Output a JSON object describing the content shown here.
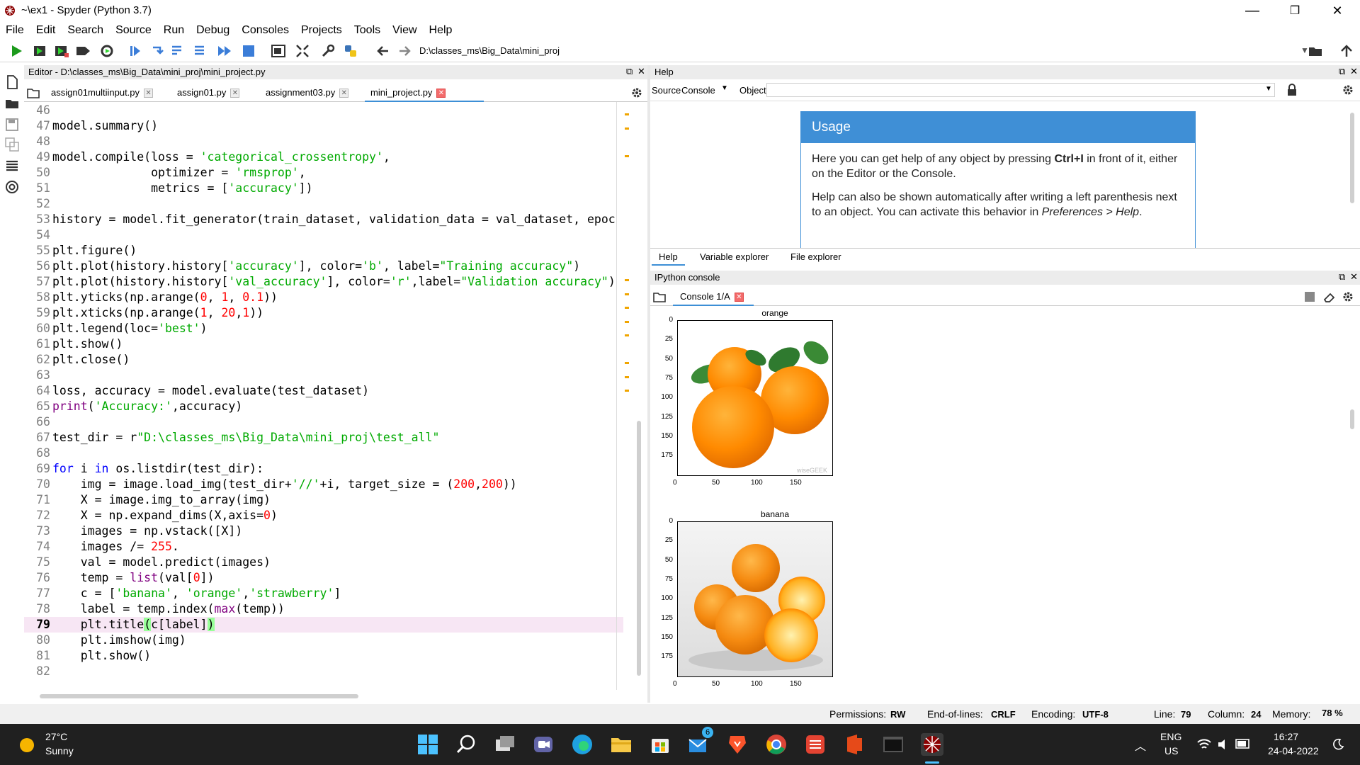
{
  "window": {
    "title": "~\\ex1 - Spyder (Python 3.7)",
    "minimize": "—",
    "restore": "❐",
    "close": "✕"
  },
  "menu": [
    "File",
    "Edit",
    "Search",
    "Source",
    "Run",
    "Debug",
    "Consoles",
    "Projects",
    "Tools",
    "View",
    "Help"
  ],
  "toolbar": {
    "path": "D:\\classes_ms\\Big_Data\\mini_proj"
  },
  "editor": {
    "header": "Editor - D:\\classes_ms\\Big_Data\\mini_proj\\mini_project.py",
    "tabs": [
      {
        "label": "assign01multiinput.py",
        "active": false
      },
      {
        "label": "assign01.py",
        "active": false
      },
      {
        "label": "assignment03.py",
        "active": false
      },
      {
        "label": "mini_project.py",
        "active": true
      }
    ],
    "current_line": 79,
    "lines": [
      {
        "n": "46",
        "html": ""
      },
      {
        "n": "47",
        "html": "model.summary()"
      },
      {
        "n": "48",
        "html": ""
      },
      {
        "n": "49",
        "html": "model.compile(loss = <span class='st'>'categorical_crossentropy'</span>,"
      },
      {
        "n": "50",
        "html": "              optimizer = <span class='st'>'rmsprop'</span>,"
      },
      {
        "n": "51",
        "html": "              metrics = [<span class='st'>'accuracy'</span>])"
      },
      {
        "n": "52",
        "html": ""
      },
      {
        "n": "53",
        "html": "history = model.fit_generator(train_dataset, validation_data = val_dataset, epoc"
      },
      {
        "n": "54",
        "html": ""
      },
      {
        "n": "55",
        "html": "plt.figure()"
      },
      {
        "n": "56",
        "html": "plt.plot(history.history[<span class='st'>'accuracy'</span>], color=<span class='st'>'b'</span>, label=<span class='st'>\"Training accuracy\"</span>)"
      },
      {
        "n": "57",
        "html": "plt.plot(history.history[<span class='st'>'val_accuracy'</span>], color=<span class='st'>'r'</span>,label=<span class='st'>\"Validation accuracy\"</span>)"
      },
      {
        "n": "58",
        "html": "plt.yticks(np.arange(<span class='nm'>0</span>, <span class='nm'>1</span>, <span class='nm'>0.1</span>))"
      },
      {
        "n": "59",
        "html": "plt.xticks(np.arange(<span class='nm'>1</span>, <span class='nm'>20</span>,<span class='nm'>1</span>))"
      },
      {
        "n": "60",
        "html": "plt.legend(loc=<span class='st'>'best'</span>)"
      },
      {
        "n": "61",
        "html": "plt.show()"
      },
      {
        "n": "62",
        "html": "plt.close()"
      },
      {
        "n": "63",
        "html": ""
      },
      {
        "n": "64",
        "html": "loss, accuracy = model.evaluate(test_dataset)"
      },
      {
        "n": "65",
        "html": "<span class='bi'>print</span>(<span class='st'>'Accuracy:'</span>,accuracy)"
      },
      {
        "n": "66",
        "html": ""
      },
      {
        "n": "67",
        "html": "test_dir = r<span class='st'>\"D:\\classes_ms\\Big_Data\\mini_proj\\test_all\"</span>"
      },
      {
        "n": "68",
        "html": ""
      },
      {
        "n": "69",
        "html": "<span class='kw'>for</span> i <span class='kw'>in</span> os.listdir(test_dir):"
      },
      {
        "n": "70",
        "html": "    img = image.load_img(test_dir+<span class='st'>'//'</span>+i, target_size = (<span class='nm'>200</span>,<span class='nm'>200</span>))"
      },
      {
        "n": "71",
        "html": "    X = image.img_to_array(img)"
      },
      {
        "n": "72",
        "html": "    X = np.expand_dims(X,axis=<span class='nm'>0</span>)"
      },
      {
        "n": "73",
        "html": "    images = np.vstack([X])"
      },
      {
        "n": "74",
        "html": "    images /= <span class='nm'>255</span>."
      },
      {
        "n": "75",
        "html": "    val = model.predict(images)"
      },
      {
        "n": "76",
        "html": "    temp = <span class='bi'>list</span>(val[<span class='nm'>0</span>])"
      },
      {
        "n": "77",
        "html": "    c = [<span class='st'>'banana'</span>, <span class='st'>'orange'</span>,<span class='st'>'strawberry'</span>]"
      },
      {
        "n": "78",
        "html": "    label = temp.index(<span class='bi'>max</span>(temp))"
      },
      {
        "n": "79",
        "html": "    plt.title<span class='hl'>(</span>c[label]<span class='hl'>)</span>"
      },
      {
        "n": "80",
        "html": "    plt.imshow(img)"
      },
      {
        "n": "81",
        "html": "    plt.show()"
      },
      {
        "n": "82",
        "html": ""
      }
    ]
  },
  "help": {
    "header": "Help",
    "source_label": "Source",
    "source_value": "Console",
    "object_label": "Object",
    "usage_title": "Usage",
    "usage_p1_a": "Here you can get help of any object by pressing ",
    "usage_p1_key": "Ctrl+I",
    "usage_p1_b": " in front of it, either on the Editor or the Console.",
    "usage_p2_a": "Help can also be shown automatically after writing a left parenthesis next to an object. You can activate this behavior in ",
    "usage_p2_link": "Preferences > Help",
    "usage_p2_b": ".",
    "tabs": [
      "Help",
      "Variable explorer",
      "File explorer"
    ]
  },
  "ipython": {
    "header": "IPython console",
    "tab_label": "Console 1/A",
    "plots": [
      {
        "title": "orange",
        "yticks": [
          "0",
          "25",
          "50",
          "75",
          "100",
          "125",
          "150",
          "175"
        ],
        "xticks": [
          "0",
          "50",
          "100",
          "150"
        ],
        "watermark": "wiseGEEK"
      },
      {
        "title": "banana",
        "yticks": [
          "0",
          "25",
          "50",
          "75",
          "100",
          "125",
          "150",
          "175"
        ],
        "xticks": [
          "0",
          "50",
          "100",
          "150"
        ]
      }
    ]
  },
  "status": {
    "permissions_label": "Permissions:",
    "permissions": "RW",
    "eol_label": "End-of-lines:",
    "eol": "CRLF",
    "encoding_label": "Encoding:",
    "encoding": "UTF-8",
    "line_label": "Line:",
    "line": "79",
    "column_label": "Column:",
    "column": "24",
    "memory_label": "Memory:",
    "memory": "78 %"
  },
  "taskbar": {
    "temp": "27°C",
    "condition": "Sunny",
    "lang1": "ENG",
    "lang2": "US",
    "time": "16:27",
    "date": "24-04-2022",
    "mail_badge": "6"
  },
  "colors": {
    "accent": "#3f8fd6",
    "string": "#00aa00",
    "number": "#ff0000",
    "keyword": "#0000ff",
    "builtin": "#800080",
    "current_line": "#f7e6f4",
    "taskbar": "#202020"
  }
}
